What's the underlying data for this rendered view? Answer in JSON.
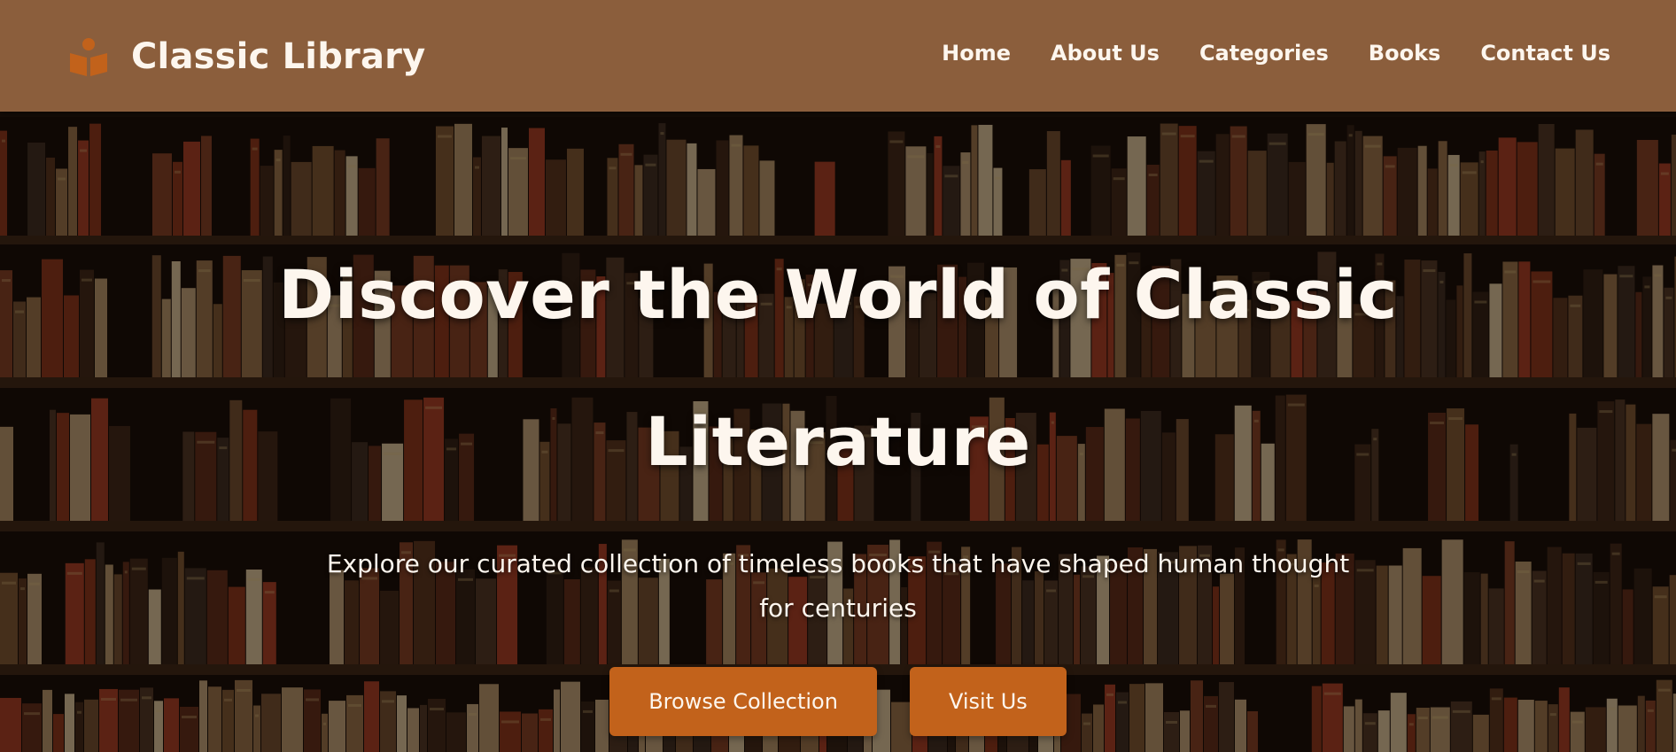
{
  "header": {
    "brand_name": "Classic Library",
    "brand_icon": "open-book-reader-icon",
    "nav": [
      {
        "label": "Home"
      },
      {
        "label": "About Us"
      },
      {
        "label": "Categories"
      },
      {
        "label": "Books"
      },
      {
        "label": "Contact Us"
      }
    ]
  },
  "hero": {
    "title": "Discover the World of Classic Literature",
    "subtitle": "Explore our curated collection of timeless books that have shaped human thought for centuries",
    "buttons": {
      "primary_label": "Browse Collection",
      "secondary_label": "Visit Us"
    },
    "background": "bookshelf-photo"
  },
  "colors": {
    "header_bg": "#8b5e3c",
    "accent": "#c2621b",
    "text_light": "#fdf6ee"
  }
}
